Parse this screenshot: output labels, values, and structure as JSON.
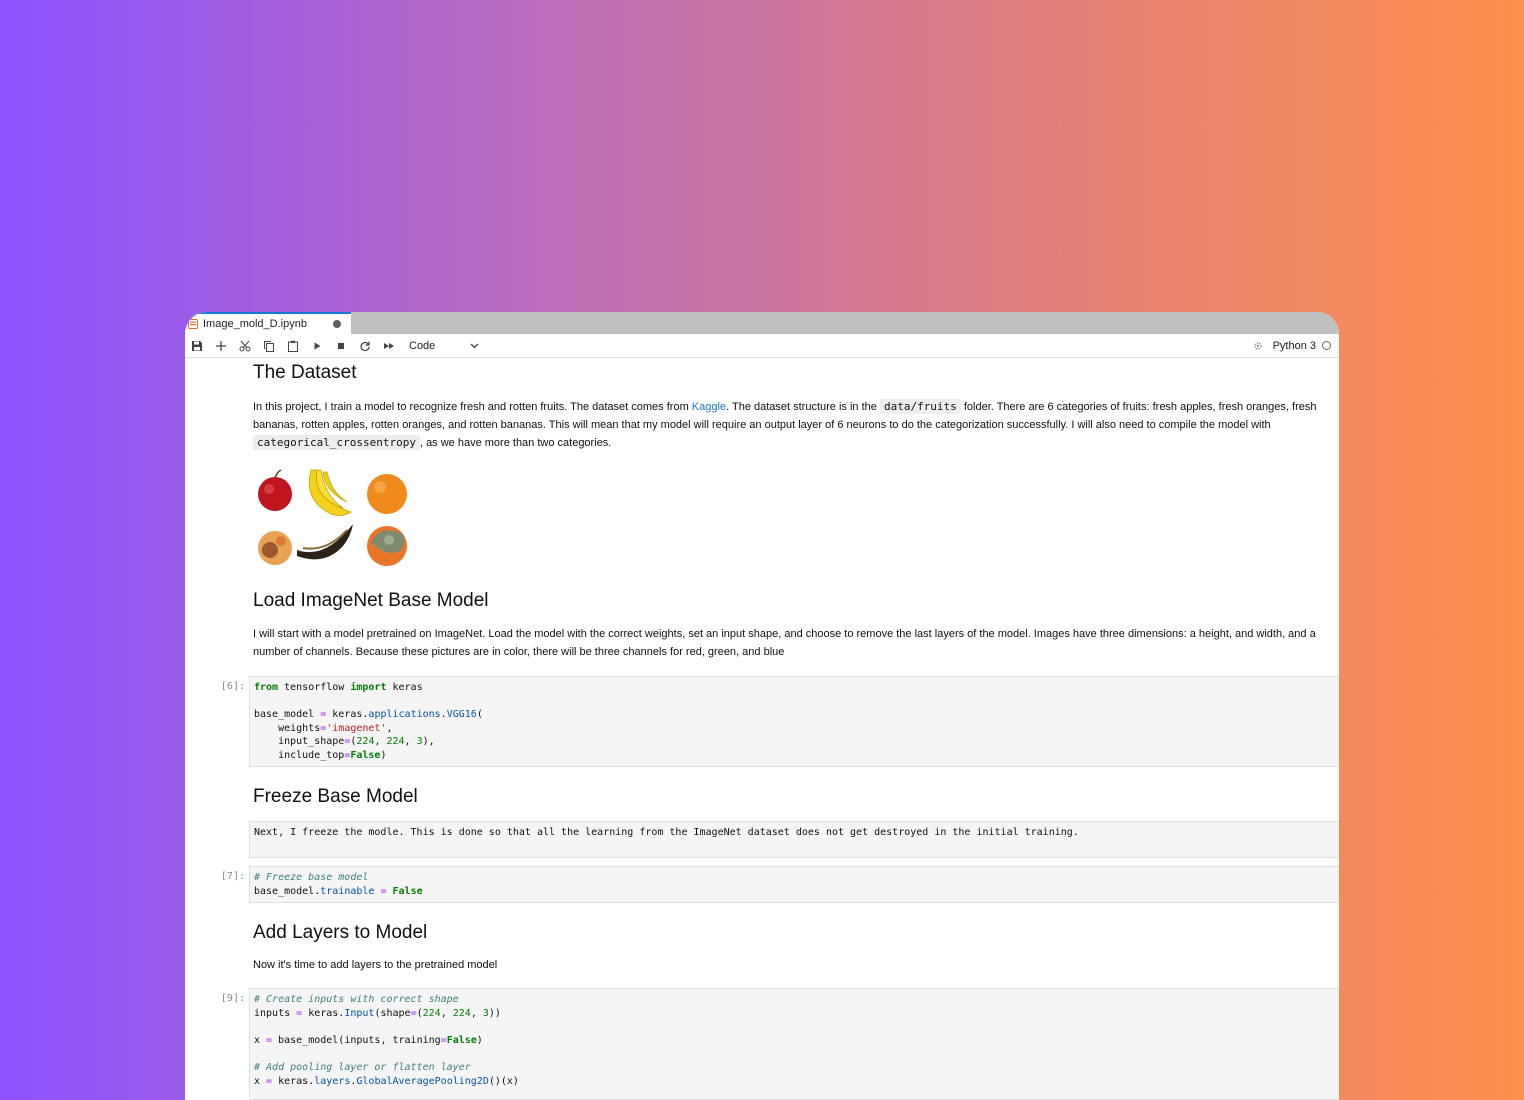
{
  "tab": {
    "filename": "Image_mold_D.ipynb"
  },
  "toolbar": {
    "cell_type": "Code",
    "kernel_name": "Python 3"
  },
  "cells": {
    "dataset": {
      "heading": "The Dataset",
      "p1": "In this project, I train a model to recognize fresh and rotten fruits. The dataset comes from ",
      "link": "Kaggle",
      "p2": ". The dataset structure is in the ",
      "code1": "data/fruits",
      "p3": " folder. There are 6 categories of fruits: fresh apples, fresh oranges, fresh bananas, rotten apples, rotten oranges, and rotten bananas. This will mean that my model will require an output layer of 6 neurons to do the categorization successfully. I will also need to compile the model with ",
      "code2": "categorical_crossentropy",
      "p4": ", as we have more than two categories."
    },
    "imagenet": {
      "heading": "Load ImageNet Base Model",
      "text": "I will start with a model pretrained on ImageNet. Load the model with the correct weights, set an input shape, and choose to remove the last layers of the model. Images have three dimensions: a height, and width, and a number of channels. Because these pictures are in color, there will be three channels for red, green, and blue"
    },
    "code6": {
      "prompt": "[6]:",
      "t_from": "from",
      "t_mod": " tensorflow ",
      "t_import": "import",
      "t_keras": " keras",
      "t_bm": "base_model ",
      "t_eq": "=",
      "t_keras2": " keras.",
      "t_apps": "applications",
      "t_dot": ".",
      "t_vgg": "VGG16",
      "t_paren": "(",
      "t_weights": "    weights",
      "t_imagenet": "'imagenet'",
      "t_comma": ",",
      "t_inshape": "    input_shape",
      "t_n224a": "224",
      "t_n224b": "224",
      "t_n3": "3",
      "t_inctop": "    include_top",
      "t_false": "False"
    },
    "freeze": {
      "heading": "Freeze Base Model",
      "raw": "Next, I freeze the modle. This is done so that all the learning from the ImageNet dataset does not get destroyed in the initial training."
    },
    "code7": {
      "prompt": "[7]:",
      "comment": "# Freeze base model",
      "t_bm": "base_model.",
      "t_trainable": "trainable",
      "t_false": "False"
    },
    "addlayers": {
      "heading": "Add Layers to Model",
      "text": "Now it's time to add layers to the pretrained model"
    },
    "code9": {
      "prompt": "[9]:",
      "comment1": "# Create inputs with correct shape",
      "t_inputs": "inputs ",
      "t_keras": " keras.",
      "t_input": "Input",
      "t_shape": "(shape",
      "t_n224a": "224",
      "t_n224b": "224",
      "t_n3": "3",
      "t_x": "x ",
      "t_bmcall": " base_model(inputs, training",
      "t_false": "False",
      "comment2": "# Add pooling layer or flatten layer",
      "t_layers": "layers",
      "t_gap": "GlobalAveragePooling2D",
      "t_tail": "()(x)"
    }
  }
}
